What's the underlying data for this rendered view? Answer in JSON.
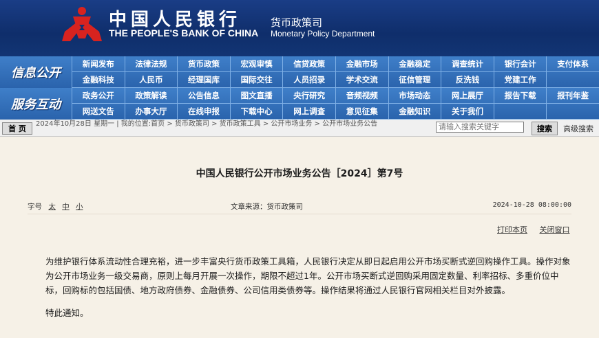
{
  "header": {
    "bank_name_cn": "中国人民银行",
    "bank_name_en": "THE PEOPLE'S BANK OF CHINA",
    "dept_cn": "货币政策司",
    "dept_en": "Monetary Policy Department"
  },
  "nav": {
    "row1_label": "信息公开",
    "row1_items": [
      "新闻发布",
      "法律法规",
      "货币政策",
      "宏观审慎",
      "信贷政策",
      "金融市场",
      "金融稳定",
      "调查统计",
      "银行会计",
      "支付体系",
      "金融科技",
      "人民币",
      "经理国库",
      "国际交往",
      "人员招录",
      "学术交流",
      "征信管理",
      "反洗钱",
      "党建工作",
      ""
    ],
    "row2_label": "服务互动",
    "row2_items": [
      "政务公开",
      "政策解读",
      "公告信息",
      "图文直播",
      "央行研究",
      "音频视频",
      "市场动态",
      "网上展厅",
      "报告下载",
      "报刊年鉴",
      "网送文告",
      "办事大厅",
      "在线申报",
      "下载中心",
      "网上调查",
      "意见征集",
      "金融知识",
      "关于我们",
      "",
      ""
    ]
  },
  "infobar": {
    "home_label": "首 页",
    "breadcrumb": "2024年10月28日 星期一 | 我的位置:首页 > 货币政策司 > 货币政策工具 > 公开市场业务 > 公开市场业务公告",
    "search_placeholder": "请输入搜索关键字",
    "search_button": "搜索",
    "advanced_search": "高级搜索"
  },
  "article": {
    "title": "中国人民银行公开市场业务公告［2024］第7号",
    "font_size_label": "字号",
    "font_sizes": [
      "太",
      "中",
      "小"
    ],
    "source": "文章来源：货币政策司",
    "date": "2024-10-28 08:00:00",
    "print_label": "打印本页",
    "close_label": "关闭窗口",
    "paragraph1": "为维护银行体系流动性合理充裕，进一步丰富央行货币政策工具箱，人民银行决定从即日起启用公开市场买断式逆回购操作工具。操作对象为公开市场业务一级交易商，原则上每月开展一次操作，期限不超过1年。公开市场买断式逆回购采用固定数量、利率招标、多重价位中标，回购标的包括国债、地方政府债券、金融债券、公司信用类债券等。操作结果将通过人民银行官网相关栏目对外披露。",
    "paragraph2": "特此通知。"
  }
}
